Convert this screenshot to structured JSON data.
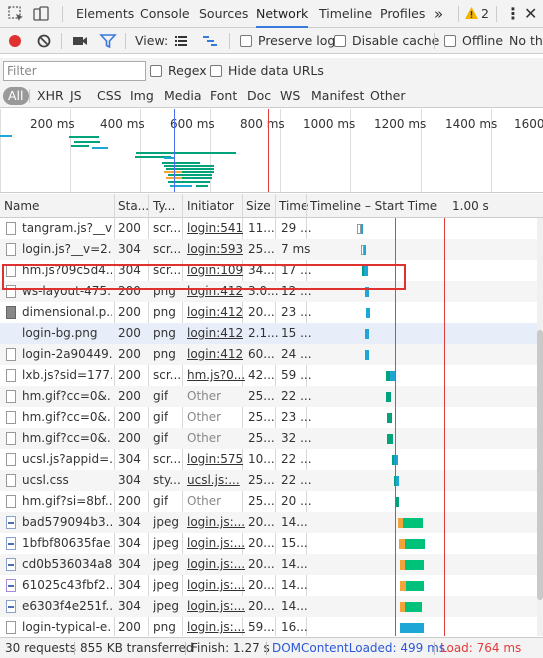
{
  "tabs": {
    "elements": "Elements",
    "console": "Console",
    "sources": "Sources",
    "network": "Network",
    "timeline": "Timeline",
    "profiles": "Profiles",
    "more": "»",
    "warnings": "2"
  },
  "toolbar": {
    "view_label": "View:",
    "preserve_log": "Preserve log",
    "disable_cache": "Disable cache",
    "offline": "Offline",
    "throttle": "No thro"
  },
  "filter": {
    "placeholder": "Filter",
    "regex": "Regex",
    "hide_data_urls": "Hide data URLs"
  },
  "types": [
    "All",
    "XHR",
    "JS",
    "CSS",
    "Img",
    "Media",
    "Font",
    "Doc",
    "WS",
    "Manifest",
    "Other"
  ],
  "overview": {
    "ticks": [
      "200 ms",
      "400 ms",
      "600 ms",
      "800 ms",
      "1000 ms",
      "1200 ms",
      "1400 ms",
      "1600"
    ]
  },
  "columns": {
    "name": "Name",
    "status": "Sta...",
    "type": "Ty...",
    "initiator": "Initiator",
    "size": "Size",
    "time": "Time",
    "timeline": "Timeline – Start Time",
    "timeline_mark": "1.00 s"
  },
  "rows": [
    {
      "name": "tangram.js?__v...",
      "status": "200",
      "type": "scr...",
      "initiator": "login:541",
      "size": "11...",
      "time": "29 ..."
    },
    {
      "name": "login.js?__v=2...",
      "status": "304",
      "type": "scr...",
      "initiator": "login:593",
      "size": "25...",
      "time": "7 ms"
    },
    {
      "name": "hm.js?09c5d4...",
      "status": "304",
      "type": "scr...",
      "initiator": "login:109",
      "size": "34...",
      "time": "17 ..."
    },
    {
      "name": "ws-layout-475...",
      "status": "200",
      "type": "png",
      "initiator": "login:412",
      "size": "3.0...",
      "time": "12 ..."
    },
    {
      "name": "dimensional.p...",
      "status": "200",
      "type": "png",
      "initiator": "login:412",
      "size": "20...",
      "time": "23 ..."
    },
    {
      "name": "login-bg.png",
      "status": "200",
      "type": "png",
      "initiator": "login:412",
      "size": "2.1...",
      "time": "15 ..."
    },
    {
      "name": "login-2a90449...",
      "status": "200",
      "type": "png",
      "initiator": "login:412",
      "size": "60...",
      "time": "24 ..."
    },
    {
      "name": "lxb.js?sid=177...",
      "status": "200",
      "type": "scr...",
      "initiator": "hm.js?0...",
      "size": "42...",
      "time": "59 ..."
    },
    {
      "name": "hm.gif?cc=0&...",
      "status": "200",
      "type": "gif",
      "initiator": "Other",
      "size": "25...",
      "time": "22 ..."
    },
    {
      "name": "hm.gif?cc=0&...",
      "status": "200",
      "type": "gif",
      "initiator": "Other",
      "size": "25...",
      "time": "23 ..."
    },
    {
      "name": "hm.gif?cc=0&...",
      "status": "200",
      "type": "gif",
      "initiator": "Other",
      "size": "25...",
      "time": "32 ..."
    },
    {
      "name": "ucsl.js?appid=...",
      "status": "304",
      "type": "scr...",
      "initiator": "login:575",
      "size": "10...",
      "time": "22 ..."
    },
    {
      "name": "ucsl.css",
      "status": "304",
      "type": "sty...",
      "initiator": "ucsl.js:...",
      "size": "25...",
      "time": "22 ..."
    },
    {
      "name": "hm.gif?si=8bf...",
      "status": "200",
      "type": "gif",
      "initiator": "Other",
      "size": "25...",
      "time": "20 ..."
    },
    {
      "name": "bad579094b3...",
      "status": "304",
      "type": "jpeg",
      "initiator": "login.js:...",
      "size": "20...",
      "time": "14..."
    },
    {
      "name": "1bfbf80635fae...",
      "status": "304",
      "type": "jpeg",
      "initiator": "login.js:...",
      "size": "20...",
      "time": "15..."
    },
    {
      "name": "cd0b536034a8...",
      "status": "304",
      "type": "jpeg",
      "initiator": "login.js:...",
      "size": "20...",
      "time": "14..."
    },
    {
      "name": "61025c43fbf2...",
      "status": "304",
      "type": "jpeg",
      "initiator": "login.js:...",
      "size": "20...",
      "time": "14..."
    },
    {
      "name": "e6303f4e251f...",
      "status": "304",
      "type": "jpeg",
      "initiator": "login.js:...",
      "size": "20...",
      "time": "14..."
    },
    {
      "name": "login-typical-e...",
      "status": "200",
      "type": "png",
      "initiator": "login.js:...",
      "size": "59...",
      "time": "16..."
    }
  ],
  "status": {
    "requests": "30 requests",
    "transferred": "855 KB transferred",
    "finish": "Finish: 1.27 s",
    "dom": "DOMContentLoaded: 499 ms",
    "load": "Load: 764 ms"
  },
  "colors": {
    "accent": "#3879d9",
    "record": "#e03131",
    "dom_line": "#4a6ff4",
    "load_line": "#e23b3b",
    "wait": "#00a37a",
    "receive": "#1ea6d6",
    "queue": "#f2a33a"
  }
}
